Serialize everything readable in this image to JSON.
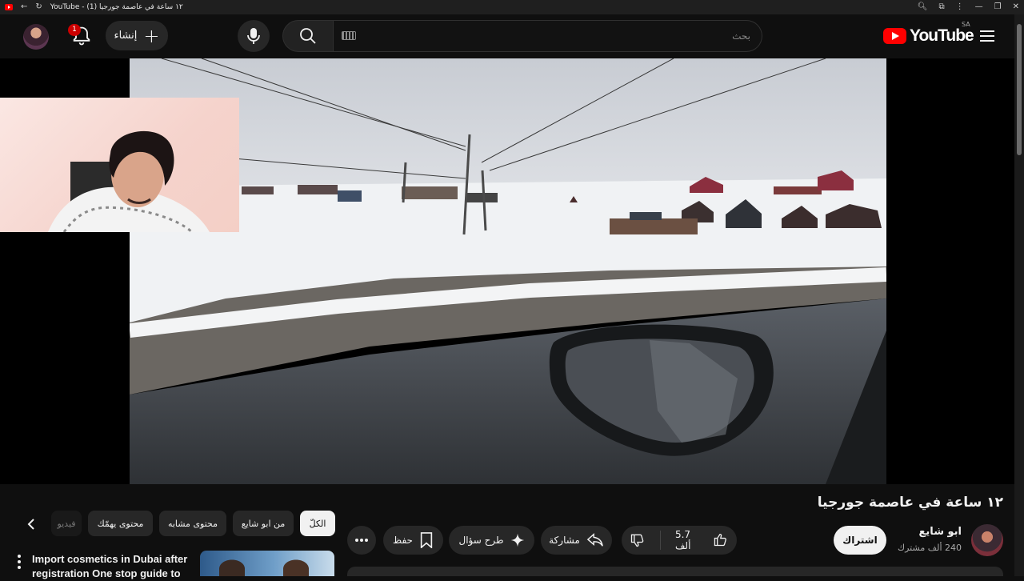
{
  "browser": {
    "tab_title": "YouTube - (1) ١٢ ساعة في عاصمة جورجيا"
  },
  "masthead": {
    "notification_count": "1",
    "create_label": "إنشاء",
    "search_placeholder": "بحث",
    "logo_text": "YouTube",
    "country_code": "SA"
  },
  "video": {
    "title": "١٢ ساعة في عاصمة جورجيا"
  },
  "channel": {
    "name": "ابو شايع",
    "subscribers": "240 ألف مشترك",
    "subscribe_label": "اشتراك"
  },
  "actions": {
    "likes": "5.7 ألف",
    "share_label": "مشاركة",
    "ask_label": "طرح سؤال",
    "save_label": "حفظ"
  },
  "chips": [
    {
      "label": "الكلّ",
      "active": true
    },
    {
      "label": "من ابو شايع",
      "active": false
    },
    {
      "label": "محتوى مشابه",
      "active": false
    },
    {
      "label": "محتوى يهمّك",
      "active": false
    },
    {
      "label": "فيديو",
      "active": false
    }
  ],
  "recommendation": {
    "title": "Import cosmetics in Dubai after registration One stop guide to"
  },
  "colors": {
    "background": "#0f0f0f",
    "pill": "#272727",
    "brand_red": "#ff0000"
  }
}
